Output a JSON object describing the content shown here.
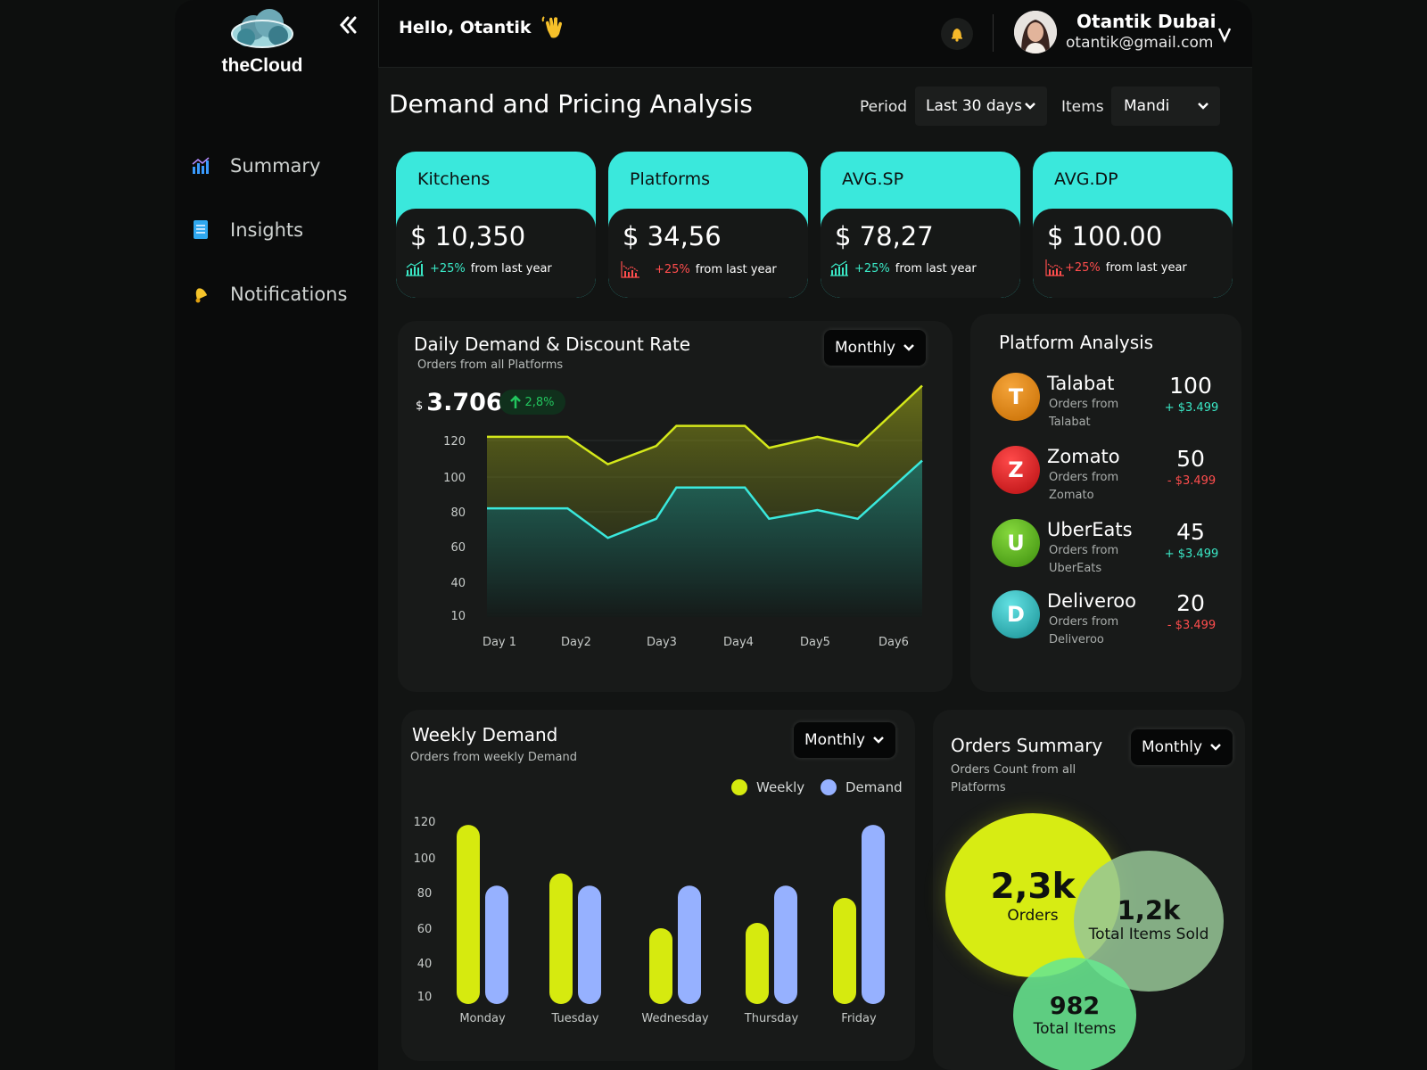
{
  "app": {
    "name": "theCloud"
  },
  "nav": {
    "items": [
      {
        "label": "Summary"
      },
      {
        "label": "Insights"
      },
      {
        "label": "Notifications"
      }
    ]
  },
  "topbar": {
    "greeting": "Hello, Otantik",
    "user_name": "Otantik  Dubai",
    "user_email": "otantik@gmail.com"
  },
  "page": {
    "title": "Demand and Pricing Analysis",
    "period_label": "Period",
    "period_value": "Last 30 days",
    "items_label": "Items",
    "items_value": "Mandi"
  },
  "kpis": [
    {
      "title": "Kitchens",
      "value": "$ 10,350",
      "change": "+25%",
      "change_suffix": "from last year",
      "trend": "up"
    },
    {
      "title": "Platforms",
      "value": "$ 34,56",
      "change": "+25%",
      "change_suffix": "from last year",
      "trend": "down"
    },
    {
      "title": "AVG.SP",
      "value": "$ 78,27",
      "change": "+25%",
      "change_suffix": "from last year",
      "trend": "up"
    },
    {
      "title": "AVG.DP",
      "value": "$ 100.00",
      "change": "+25%",
      "change_suffix": "from last year",
      "trend": "down"
    }
  ],
  "daily": {
    "title": "Daily Demand & Discount Rate",
    "subtitle": "Orders from all Platforms",
    "filter": "Monthly",
    "currency": "$",
    "total": "3.706",
    "badge": "2,8%"
  },
  "platform_analysis": {
    "title": "Platform Analysis",
    "rows": [
      {
        "initial": "T",
        "name": "Talabat",
        "sub": "Orders from Talabat",
        "count": "100",
        "delta": "+ $3.499",
        "trend": "up",
        "color": "#d8860b"
      },
      {
        "initial": "Z",
        "name": "Zomato",
        "sub": "Orders from Zomato",
        "count": "50",
        "delta": "- $3.499",
        "trend": "down",
        "color": "#d9181b"
      },
      {
        "initial": "U",
        "name": "UberEats",
        "sub": "Orders from UberEats",
        "count": "45",
        "delta": "+ $3.499",
        "trend": "up",
        "color": "#53b417"
      },
      {
        "initial": "D",
        "name": "Deliveroo",
        "sub": "Orders from Deliveroo",
        "count": "20",
        "delta": "- $3.499",
        "trend": "down",
        "color": "#2ec2c6"
      }
    ]
  },
  "weekly": {
    "title": "Weekly Demand",
    "subtitle": "Orders from  weekly Demand",
    "filter": "Monthly",
    "legend": [
      "Weekly",
      "Demand"
    ]
  },
  "orders_summary": {
    "title": "Orders Summary",
    "subtitle": "Orders Count from all Platforms",
    "filter": "Monthly",
    "orders_value": "2,3k",
    "orders_label": "Orders",
    "sold_value": "1,2k",
    "sold_label": "Total Items Sold",
    "items_value": "982",
    "items_label": "Total Items"
  },
  "colors": {
    "accent": "#3ae8dc",
    "lime": "#d6ea0f",
    "periwinkle": "#96b1ff",
    "positive": "#3ae8c6",
    "negative": "#ff4d4d"
  },
  "chart_data": [
    {
      "type": "area",
      "x": [
        "Day 1",
        "Day2",
        "Day3",
        "Day4",
        "Day5",
        "Day6"
      ],
      "y_ticks": [
        120,
        100,
        80,
        60,
        40,
        10
      ],
      "series": [
        {
          "values": [
            122,
            122,
            107,
            117,
            128,
            128,
            116,
            122,
            117,
            150
          ]
        },
        {
          "values": [
            82,
            82,
            65,
            76,
            94,
            94,
            76,
            81,
            76,
            109
          ]
        }
      ],
      "series_x": [
        0,
        1,
        1.5,
        2.1,
        2.35,
        3.2,
        3.5,
        4.1,
        4.6,
        5.4
      ]
    },
    {
      "type": "bar",
      "categories": [
        "Monday",
        "Tuesday",
        "Wednesday",
        "Thursday",
        "Friday"
      ],
      "y_ticks": [
        120,
        100,
        80,
        60,
        40,
        10
      ],
      "ylim": [
        10,
        120
      ],
      "series": [
        {
          "name": "Weekly",
          "values": [
            118,
            91,
            60,
            63,
            77
          ]
        },
        {
          "name": "Demand",
          "values": [
            84,
            84,
            84,
            84,
            118
          ]
        }
      ]
    }
  ]
}
